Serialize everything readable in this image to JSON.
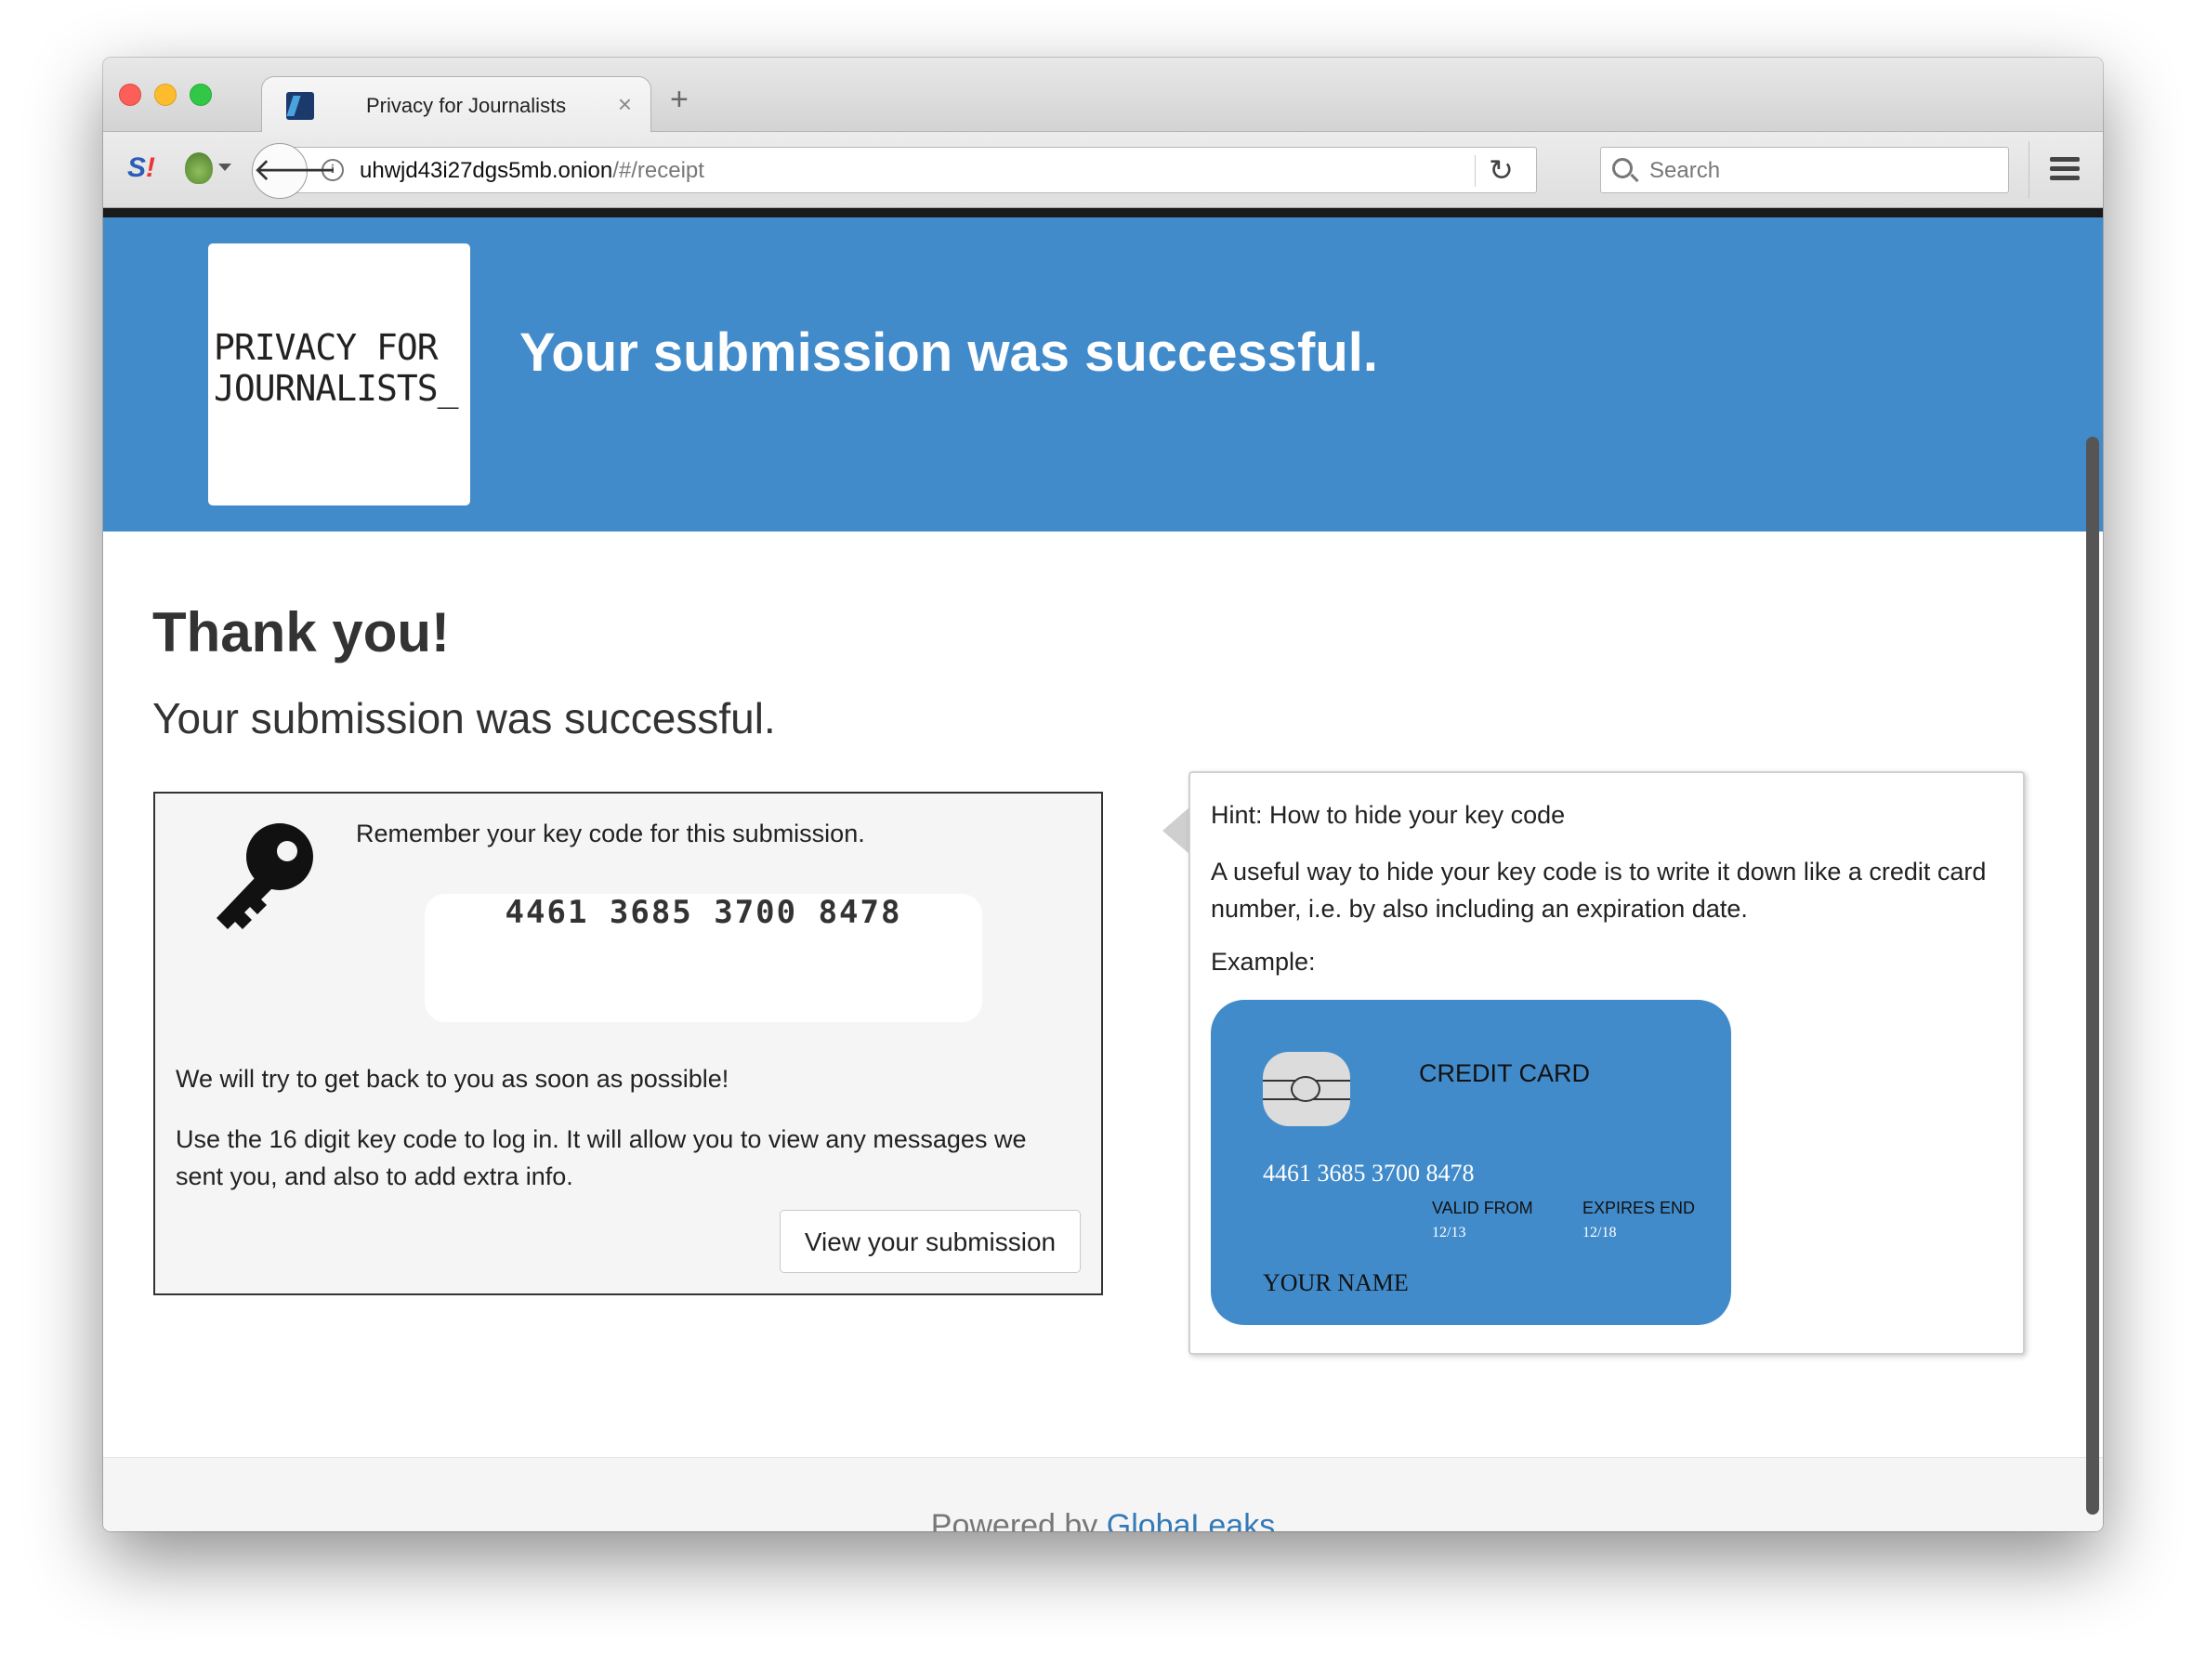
{
  "browser": {
    "tab_title": "Privacy for Journalists",
    "tab_close": "×",
    "new_tab": "+",
    "url_host": "uhwjd43i27dgs5mb.onion",
    "url_path": "/#/receipt",
    "search_placeholder": "Search",
    "back_glyph": "🡐",
    "reload_glyph": "↻"
  },
  "header": {
    "logo_line1": "PRIVACY FOR",
    "logo_line2": "JOURNALISTS_",
    "title": "Your submission was successful."
  },
  "main": {
    "heading": "Thank you!",
    "subheading": "Your submission was successful.",
    "remember_text": "Remember your key code for this submission.",
    "key_code": "4461 3685 3700 8478",
    "back_text": "We will try to get back to you as soon as possible!",
    "use_text": "Use the 16 digit key code to log in. It will allow you to view any messages we sent you, and also to add extra info.",
    "view_button": "View your submission"
  },
  "hint": {
    "title": "Hint: How to hide your key code",
    "body": "A useful way to hide your key code is to write it down like a credit card number, i.e. by also including an expiration date.",
    "example_label": "Example:",
    "card": {
      "label": "CREDIT CARD",
      "number": "4461 3685 3700 8478",
      "valid_from_label": "VALID FROM",
      "valid_from": "12/13",
      "expires_label": "EXPIRES END",
      "expires": "12/18",
      "name": "YOUR NAME"
    }
  },
  "footer": {
    "powered_by": "Powered by",
    "link": "GlobaLeaks"
  },
  "colors": {
    "brand_blue": "#428bca",
    "link_blue": "#337ab7"
  }
}
